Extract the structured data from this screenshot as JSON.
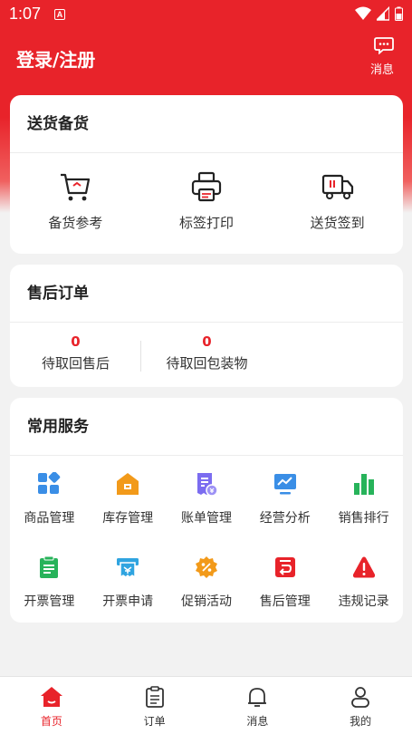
{
  "status_bar": {
    "time": "1:07",
    "app_badge": "A"
  },
  "header": {
    "title": "登录/注册",
    "message_label": "消息"
  },
  "delivery": {
    "title": "送货备货",
    "items": [
      {
        "label": "备货参考",
        "icon": "cart-icon"
      },
      {
        "label": "标签打印",
        "icon": "printer-icon"
      },
      {
        "label": "送货签到",
        "icon": "truck-icon"
      }
    ]
  },
  "after_sales": {
    "title": "售后订单",
    "items": [
      {
        "count": "0",
        "label": "待取回售后"
      },
      {
        "count": "0",
        "label": "待取回包装物"
      }
    ]
  },
  "services": {
    "title": "常用服务",
    "items": [
      {
        "label": "商品管理",
        "icon": "grid-icon"
      },
      {
        "label": "库存管理",
        "icon": "warehouse-icon"
      },
      {
        "label": "账单管理",
        "icon": "bill-icon"
      },
      {
        "label": "经营分析",
        "icon": "monitor-chart-icon"
      },
      {
        "label": "销售排行",
        "icon": "bar-chart-icon"
      },
      {
        "label": "开票管理",
        "icon": "clipboard-icon"
      },
      {
        "label": "开票申请",
        "icon": "receipt-printer-icon"
      },
      {
        "label": "促销活动",
        "icon": "percent-badge-icon"
      },
      {
        "label": "售后管理",
        "icon": "return-icon"
      },
      {
        "label": "违规记录",
        "icon": "warning-icon"
      }
    ]
  },
  "tabbar": {
    "items": [
      {
        "label": "首页",
        "icon": "home-icon",
        "active": true
      },
      {
        "label": "订单",
        "icon": "order-list-icon",
        "active": false
      },
      {
        "label": "消息",
        "icon": "bell-icon",
        "active": false
      },
      {
        "label": "我的",
        "icon": "user-icon",
        "active": false
      }
    ]
  },
  "colors": {
    "brand_red": "#e8232a",
    "blue": "#3a8ee6",
    "orange": "#f29a1a",
    "purple": "#7b6cf0",
    "green": "#27b35a",
    "red": "#e8232a"
  }
}
